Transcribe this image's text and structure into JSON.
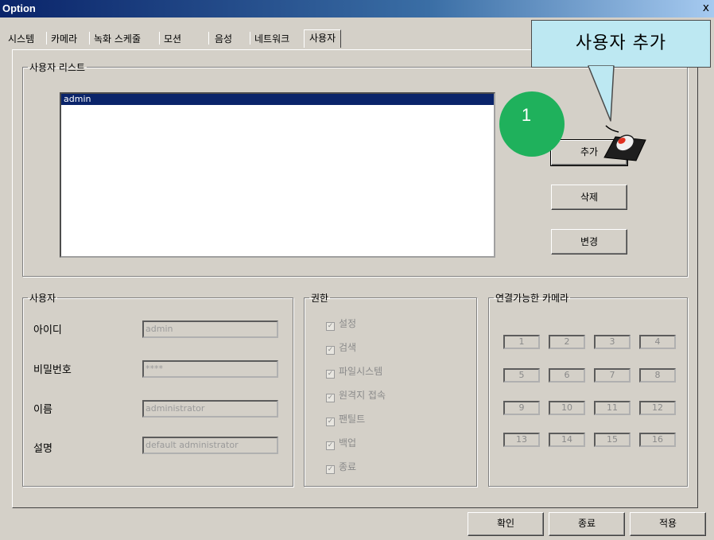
{
  "window": {
    "title": "Option",
    "close": "x"
  },
  "tabs": [
    "시스템",
    "카메라",
    "녹화 스케줄",
    "모션",
    "음성",
    "네트워크",
    "사용자"
  ],
  "user_list": {
    "legend": "사용자 리스트",
    "items": [
      "admin"
    ]
  },
  "buttons": {
    "add": "추가",
    "delete": "삭제",
    "change": "변경"
  },
  "user": {
    "legend": "사용자",
    "fields": [
      {
        "label": "아이디",
        "value": "admin"
      },
      {
        "label": "비밀번호",
        "value": "****"
      },
      {
        "label": "이름",
        "value": "administrator"
      },
      {
        "label": "설명",
        "value": "default administrator"
      }
    ]
  },
  "permissions": {
    "legend": "권한",
    "check_mark": "✓",
    "items": [
      "설정",
      "검색",
      "파일시스템",
      "원격지 접속",
      "팬틸트",
      "백업",
      "종료"
    ]
  },
  "cameras": {
    "legend": "연결가능한 카메라",
    "items": [
      "1",
      "2",
      "3",
      "4",
      "5",
      "6",
      "7",
      "8",
      "9",
      "10",
      "11",
      "12",
      "13",
      "14",
      "15",
      "16"
    ]
  },
  "footer": {
    "ok": "확인",
    "exit": "종료",
    "apply": "적용"
  },
  "annotation": {
    "callout": "사용자 추가",
    "step": "1"
  }
}
